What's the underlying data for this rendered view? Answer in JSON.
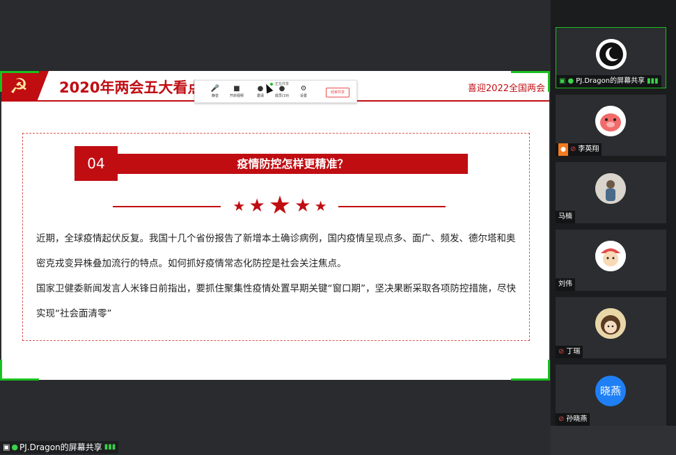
{
  "slide": {
    "title": "2020年两会五大看点",
    "subtitle": "喜迎2022全国两会",
    "section_number": "04",
    "section_title": "疫情防控怎样更精准？",
    "paragraph1": "近期，全球疫情起伏反复。我国十几个省份报告了新增本土确诊病例，国内疫情呈现点多、面广、频发、德尔塔和奥密克戎变异株叠加流行的特点。如何抓好疫情常态化防控是社会关注焦点。",
    "paragraph2": "国家卫健委新闻发言人米锋日前指出，要抓住聚集性疫情处置早期关键“窗口期”，坚决果断采取各项防控措施，尽快实现“社会面清零”"
  },
  "toolbar": {
    "recording_text": "正在共享",
    "mute_label": "静音",
    "video_label": "开启视频",
    "invite_label": "邀请",
    "members_label": "成员(19)",
    "settings_label": "设置",
    "stop_share_label": "结束共享"
  },
  "share_indicator": {
    "label": "PJ.Dragon的屏幕共享"
  },
  "participants": [
    {
      "name": "PJ.Dragon的屏幕共享",
      "avatar_text": "",
      "avatar_color": "#ffffff"
    },
    {
      "name": "李英翔",
      "avatar_text": "",
      "avatar_color": "#ffffff"
    },
    {
      "name": "马楠",
      "avatar_text": "",
      "avatar_color": "#d9d4cc"
    },
    {
      "name": "刘伟",
      "avatar_text": "",
      "avatar_color": "#ffffff"
    },
    {
      "name": "丁瑞",
      "avatar_text": "",
      "avatar_color": "#e8d6a8"
    },
    {
      "name": "孙晓燕",
      "avatar_text": "晓燕",
      "avatar_color": "#1f7ff5"
    }
  ],
  "colors": {
    "accent_red": "#c00d12",
    "active_green": "#19c11e"
  }
}
